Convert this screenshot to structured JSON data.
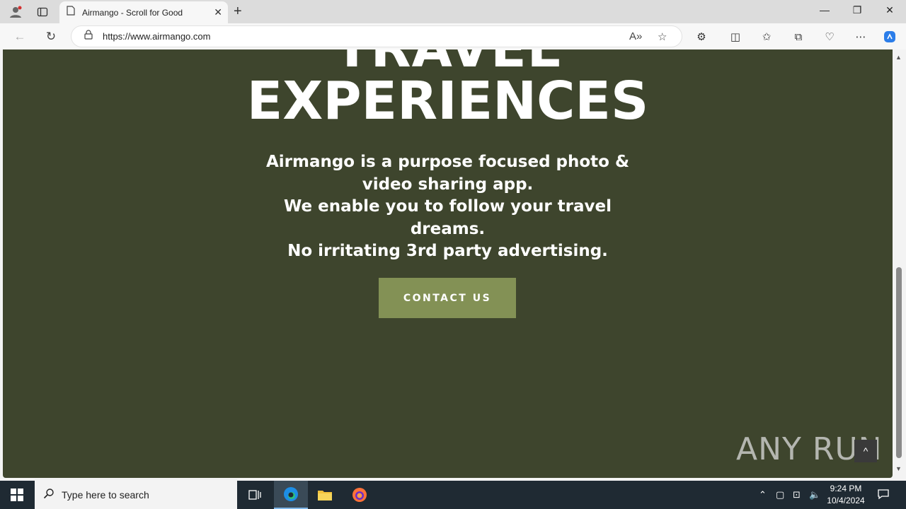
{
  "browser": {
    "tab_title": "Airmango - Scroll for Good",
    "new_tab_label": "+",
    "url": "https://www.airmango.com"
  },
  "page": {
    "partial_heading": "TRAVEL",
    "heading": "EXPERIENCES",
    "copy_lines": [
      "Airmango is a purpose focused photo & video sharing app.",
      "We enable you to follow your travel dreams.",
      "No irritating 3rd party advertising."
    ],
    "cta_label": "CONTACT US",
    "back_to_top": "^",
    "watermark": "ANY RUN"
  },
  "colors": {
    "page_background": "#3e452d",
    "cta_background": "#839155",
    "text": "#ffffff"
  },
  "taskbar": {
    "search_placeholder": "Type here to search",
    "time": "9:24 PM",
    "date": "10/4/2024"
  },
  "icons": [
    "profile-icon",
    "tab-actions-icon",
    "page-icon",
    "close-icon",
    "back-icon",
    "refresh-icon",
    "lock-icon",
    "read-aloud-icon",
    "favorite-icon",
    "extensions-icon",
    "split-screen-icon",
    "favorites-icon",
    "collections-icon",
    "browser-essentials-icon",
    "more-icon",
    "copilot-icon",
    "windows-start-icon",
    "search-icon",
    "task-view-icon",
    "edge-icon",
    "file-explorer-icon",
    "firefox-icon"
  ]
}
